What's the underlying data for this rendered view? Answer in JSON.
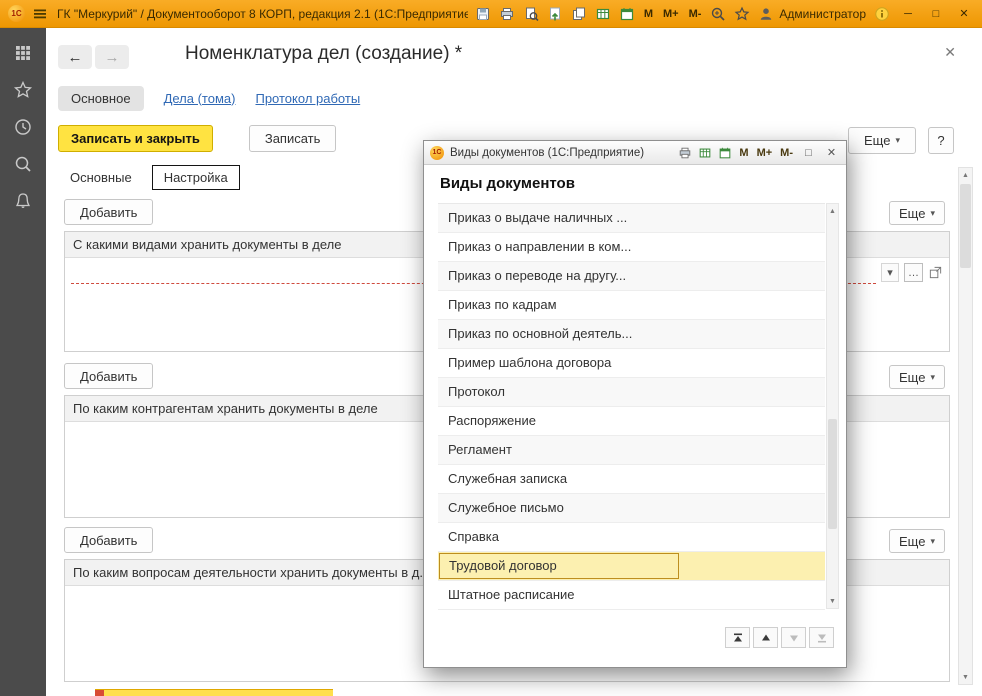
{
  "icons": {
    "chevron_down": "▾",
    "ellipsis": "…",
    "close": "✕",
    "maximize": "□",
    "minimize": "─",
    "back": "←",
    "forward": "→",
    "up": "▲",
    "down": "▼"
  },
  "titlebar": {
    "app_title": "ГК \"Меркурий\" / Документооборот 8 КОРП, редакция 2.1  (1С:Предприятие)",
    "logo_text": "1С",
    "memory_buttons": [
      "М",
      "М+",
      "М-"
    ],
    "user": "Администратор"
  },
  "form": {
    "title": "Номенклатура дел (создание) *",
    "nav": [
      {
        "label": "Основное",
        "active": true
      },
      {
        "label": "Дела (тома)",
        "active": false
      },
      {
        "label": "Протокол работы",
        "active": false
      }
    ],
    "actions": {
      "save_close": "Записать и закрыть",
      "save": "Записать",
      "more": "Еще",
      "help": "?"
    },
    "tabs": [
      {
        "label": "Основные",
        "focused": false
      },
      {
        "label": "Настройка",
        "focused": true
      }
    ],
    "sections": [
      {
        "add": "Добавить",
        "more": "Еще",
        "header": "С какими видами хранить документы в деле"
      },
      {
        "add": "Добавить",
        "more": "Еще",
        "header": "По каким контрагентам хранить документы в деле"
      },
      {
        "add": "Добавить",
        "more": "Еще",
        "header": "По каким вопросам деятельности хранить документы в д..."
      }
    ]
  },
  "modal": {
    "titlebar_text": "Виды документов  (1С:Предприятие)",
    "logo_text": "1С",
    "memory_buttons": [
      "М",
      "М+",
      "М-"
    ],
    "heading": "Виды документов",
    "selected_item": "Трудовой договор",
    "items": [
      {
        "label": "Приказ о выдаче наличных ...",
        "selected": false
      },
      {
        "label": "Приказ о направлении в ком...",
        "selected": false
      },
      {
        "label": "Приказ о переводе на другу...",
        "selected": false
      },
      {
        "label": "Приказ по кадрам",
        "selected": false
      },
      {
        "label": "Приказ по основной деятель...",
        "selected": false
      },
      {
        "label": "Пример шаблона договора",
        "selected": false
      },
      {
        "label": "Протокол",
        "selected": false
      },
      {
        "label": "Распоряжение",
        "selected": false
      },
      {
        "label": "Регламент",
        "selected": false
      },
      {
        "label": "Служебная записка",
        "selected": false
      },
      {
        "label": "Служебное письмо",
        "selected": false
      },
      {
        "label": "Справка",
        "selected": false
      },
      {
        "label": "Трудовой договор",
        "selected": true
      },
      {
        "label": "Штатное расписание",
        "selected": false
      }
    ]
  },
  "colors": {
    "titlebar_bg": "#f2a012",
    "primary_button_bg": "#ffe341",
    "selection_bg": "#fcf0b0",
    "selection_border": "#bd8e1e",
    "link": "#3069b5",
    "sidebar_bg": "#4b4b4b"
  }
}
